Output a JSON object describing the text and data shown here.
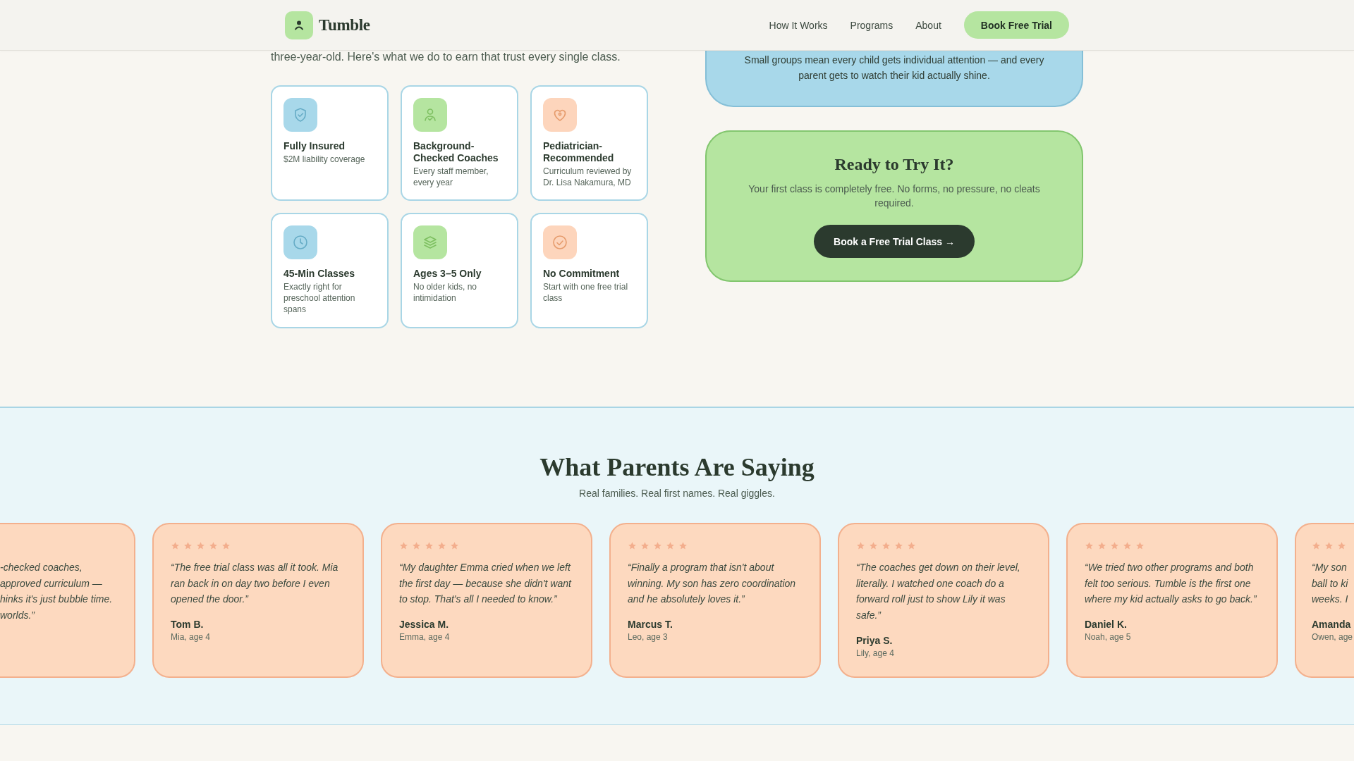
{
  "header": {
    "brand": "Tumble",
    "nav": [
      "How It Works",
      "Programs",
      "About"
    ],
    "cta": "Book Free Trial"
  },
  "trust": {
    "intro": "three-year-old. Here's what we do to earn that trust every single class.",
    "features": [
      {
        "title": "Fully Insured",
        "description": "$2M liability coverage",
        "color": "#a8d8ea"
      },
      {
        "title": "Background-Checked Coaches",
        "description": "Every staff member, every year",
        "color": "#b5e5a0"
      },
      {
        "title": "Pediatrician-Recommended",
        "description": "Curriculum reviewed by Dr. Lisa Nakamura, MD",
        "color": "#fdd5bc"
      },
      {
        "title": "45-Min Classes",
        "description": "Exactly right for preschool attention spans",
        "color": "#a8d8ea"
      },
      {
        "title": "Ages 3–5 Only",
        "description": "No older kids, no intimidation",
        "color": "#b5e5a0"
      },
      {
        "title": "No Commitment",
        "description": "Start with one free trial class",
        "color": "#fdd5bc"
      }
    ],
    "info_panel": {
      "text": "Small groups mean every child gets individual attention — and every parent gets to watch their kid actually shine."
    },
    "cta_panel": {
      "title": "Ready to Try It?",
      "text": "Your first class is completely free. No forms, no pressure, no cleats required.",
      "button": "Book a Free Trial Class →"
    }
  },
  "testimonials": {
    "title": "What Parents Are Saying",
    "subtitle": "Real families. Real first names. Real giggles.",
    "cards": [
      {
        "kind": "partial_left",
        "quote_lines": [
          "-checked coaches,",
          "approved curriculum —",
          "hinks it's just bubble time.",
          "worlds.”"
        ]
      },
      {
        "kind": "full",
        "stars": 5,
        "quote": "“The free trial class was all it took. Mia ran back in on day two before I even opened the door.”",
        "name": "Tom B.",
        "child": "Mia, age 4"
      },
      {
        "kind": "full",
        "stars": 5,
        "quote": "“My daughter Emma cried when we left the first day — because she didn't want to stop. That's all I needed to know.”",
        "name": "Jessica M.",
        "child": "Emma, age 4"
      },
      {
        "kind": "full",
        "stars": 5,
        "quote": "“Finally a program that isn't about winning. My son has zero coordination and he absolutely loves it.”",
        "name": "Marcus T.",
        "child": "Leo, age 3"
      },
      {
        "kind": "full",
        "stars": 5,
        "quote": "“The coaches get down on their level, literally. I watched one coach do a forward roll just to show Lily it was safe.”",
        "name": "Priya S.",
        "child": "Lily, age 4"
      },
      {
        "kind": "full",
        "stars": 5,
        "quote": "“We tried two other programs and both felt too serious. Tumble is the first one where my kid actually asks to go back.”",
        "name": "Daniel K.",
        "child": "Noah, age 5"
      },
      {
        "kind": "partial_right",
        "stars": 3,
        "quote_lines": [
          "“My son",
          "ball to ki",
          "weeks. I"
        ],
        "name": "Amanda",
        "child": "Owen, age"
      }
    ]
  }
}
